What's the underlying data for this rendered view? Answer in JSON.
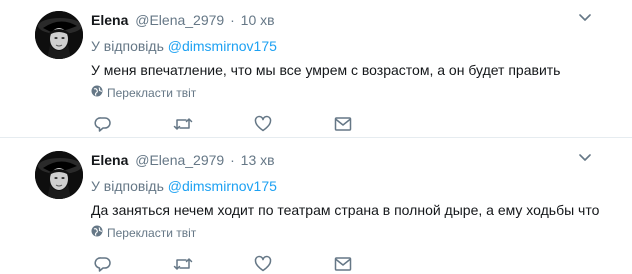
{
  "tweets": [
    {
      "name": "Elena",
      "handle": "@Elena_2979",
      "separator": "·",
      "time": "10 хв",
      "reply_prefix": "У відповідь",
      "reply_to": "@dimsmirnov175",
      "text": "У меня впечатление, что мы все умрем с возрастом, а он будет править",
      "translate_label": "Перекласти твіт",
      "icons": {
        "reply": "reply-icon",
        "retweet": "retweet-icon",
        "like": "heart-icon",
        "dm": "envelope-icon",
        "more": "chevron-down-icon",
        "translate": "globe-icon"
      }
    },
    {
      "name": "Elena",
      "handle": "@Elena_2979",
      "separator": "·",
      "time": "13 хв",
      "reply_prefix": "У відповідь",
      "reply_to": "@dimsmirnov175",
      "text": "Да заняться нечем ходит по театрам страна в полной дыре, а ему ходьбы что",
      "translate_label": "Перекласти твіт",
      "icons": {
        "reply": "reply-icon",
        "retweet": "retweet-icon",
        "like": "heart-icon",
        "dm": "envelope-icon",
        "more": "chevron-down-icon",
        "translate": "globe-icon"
      }
    }
  ],
  "colors": {
    "link": "#1da1f2",
    "secondary": "#657786",
    "text": "#14171a",
    "divider": "#e6ecf0"
  }
}
